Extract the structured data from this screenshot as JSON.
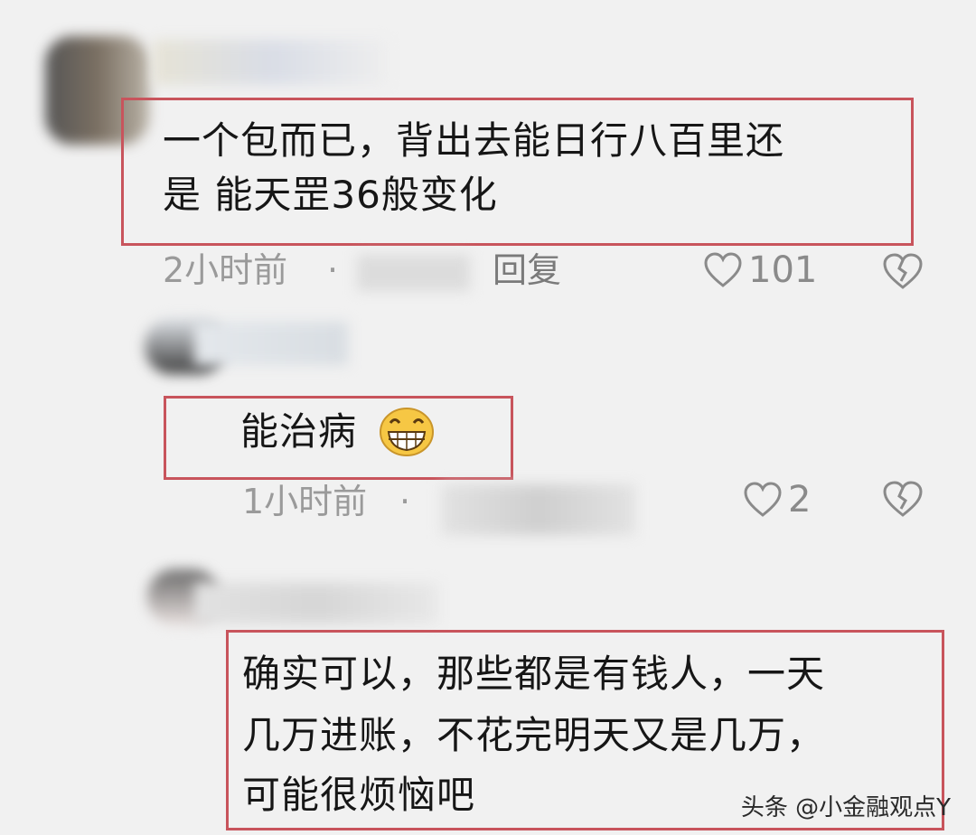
{
  "comments": [
    {
      "text_lines": [
        "一个包而已，背出去能日行八百里还",
        "是 能天罡36般变化"
      ],
      "time": "2小时前",
      "separator": "·",
      "reply_label": "回复",
      "likes": "101"
    },
    {
      "text_lines": [
        "能治病"
      ],
      "time": "1小时前",
      "separator": "·",
      "likes": "2"
    },
    {
      "text_lines": [
        "确实可以，那些都是有钱人，一天",
        "几万进账，不花完明天又是几万，",
        "可能很烦恼吧"
      ]
    }
  ],
  "watermark": "头条 @小金融观点Y",
  "icons": {
    "like": "heart-outline-icon",
    "dislike": "broken-heart-icon",
    "emoji": "grinning-face-emoji"
  }
}
